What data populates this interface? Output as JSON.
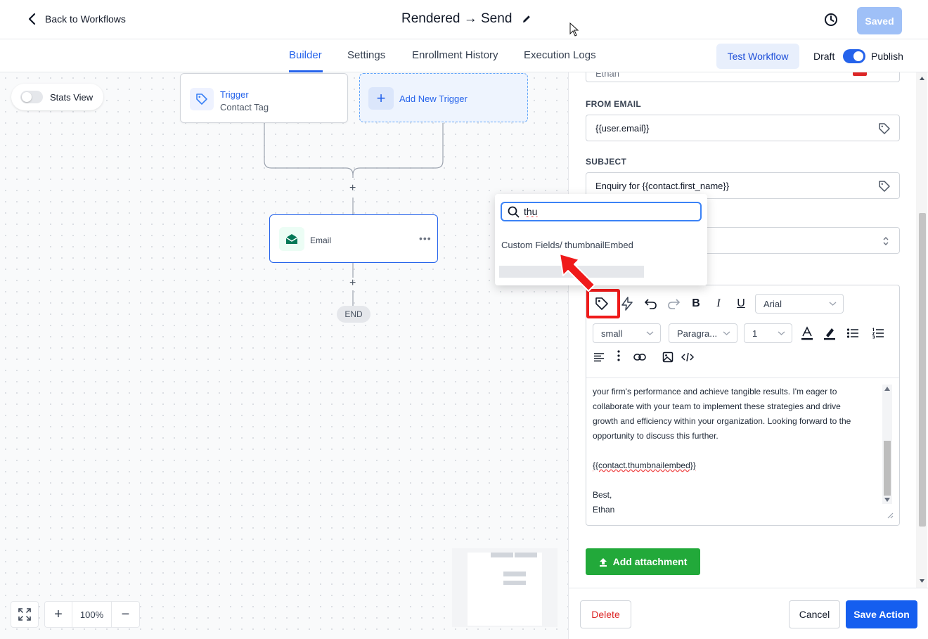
{
  "header": {
    "back_label": "Back to Workflows",
    "workflow_title": "Rendered → Send",
    "saved_label": "Saved"
  },
  "tabs": [
    {
      "label": "Builder",
      "active": true
    },
    {
      "label": "Settings"
    },
    {
      "label": "Enrollment History"
    },
    {
      "label": "Execution Logs"
    }
  ],
  "tabbar_right": {
    "test_label": "Test Workflow",
    "draft_label": "Draft",
    "publish_label": "Publish",
    "publish_toggle_on": true
  },
  "canvas": {
    "stats_label": "Stats View",
    "trigger": {
      "title": "Trigger",
      "subtitle": "Contact Tag"
    },
    "add_trigger_label": "Add New Trigger",
    "email_node_label": "Email",
    "end_label": "END",
    "zoom_level": "100%"
  },
  "dropdown": {
    "search_value": "thu",
    "item_label": "Custom Fields/ thumbnailEmbed"
  },
  "panel": {
    "from_name_value": "Ethan",
    "from_email_label": "FROM EMAIL",
    "from_email_value": "{{user.email}}",
    "subject_label": "SUBJECT",
    "subject_value": "Enquiry for {{contact.first_name}}",
    "toolbar": {
      "font_family": "Arial",
      "font_size": "small",
      "block_format": "Paragra...",
      "line_height": "1"
    },
    "body_lines": [
      "your firm's performance and achieve tangible results. I'm eager to",
      "collaborate with your team to implement these strategies and drive",
      "growth and efficiency within your organization. Looking forward to the",
      "opportunity to discuss this further."
    ],
    "body_merge_tag": "{{contact.thumbnailembed}}",
    "body_signoff": "Best,",
    "body_signature": "Ethan",
    "attach_label": "Add attachment"
  },
  "footer": {
    "delete_label": "Delete",
    "cancel_label": "Cancel",
    "save_label": "Save Action"
  },
  "colors": {
    "accent": "#2563eb",
    "attach_green": "#22a93a",
    "highlight_red": "#ef1a1a"
  }
}
